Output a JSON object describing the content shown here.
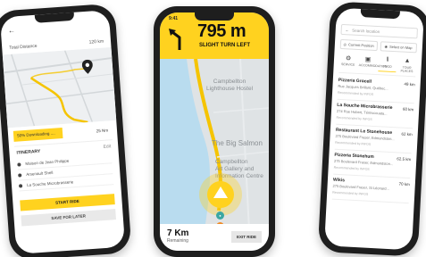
{
  "colors": {
    "accent": "#ffd21f",
    "route": "#f5c400",
    "water": "#b9dcef",
    "land": "#dfe3e5"
  },
  "phone1": {
    "title": "Total Distance",
    "distance": "120 km",
    "progress_text": "50%  Downloading ....",
    "progress_value": 0.5,
    "progress_right": "25 Nm",
    "itinerary": {
      "heading": "ITINERARY",
      "edit_label": "Edit",
      "items": [
        {
          "label": "Maison de Jean Philippe"
        },
        {
          "label": "Arsenault Shell"
        },
        {
          "label": "La Souche Microbrasserie"
        }
      ]
    },
    "start_button": "START RIDE",
    "save_button": "SAVE FOR LATER"
  },
  "phone2": {
    "status_time": "9:41",
    "distance": "795 m",
    "instruction": "SLIGHT TURN LEFT",
    "map_labels": {
      "lighthouse": "Campbellton\nLighthouse Hostel",
      "salmon": "The Big Salmon",
      "gallery": "Campbellton\nArt Gallery and\nInformation Centre"
    },
    "remaining_value": "7 Km",
    "remaining_label": "Remaining",
    "exit_button": "EXIT RIDE"
  },
  "phone3": {
    "search_placeholder": "Search location",
    "current_position": "Current Position",
    "select_on_map": "Select on Map",
    "categories": [
      {
        "label": "SERVICE",
        "icon": "service-icon"
      },
      {
        "label": "ACCOMMODATION",
        "icon": "bed-icon"
      },
      {
        "label": "FOOD",
        "icon": "fork-knife-icon"
      },
      {
        "label": "TOUR PLACES",
        "icon": "tour-icon"
      }
    ],
    "places": [
      {
        "name": "Pizzeria Grocell",
        "address": "Rue Jacques Brillant, Québec...",
        "rec": "Recommended by INFOS",
        "km": "49 km"
      },
      {
        "name": "La Souche Microbrasserie",
        "address": "274 Rue Hubert, Témiscouata...",
        "rec": "Recommended by INFOS",
        "km": "60 km"
      },
      {
        "name": "Restaurant Le Stonehouse",
        "address": "275 Boulevard Fraser, Edmundston...",
        "rec": "Recommended by INFOS",
        "km": "62 km"
      },
      {
        "name": "Pizzeria Stonehum",
        "address": "275 Boulevard Fraser, Edmundston...",
        "rec": "Recommended by INFOS",
        "km": "62.5 km"
      },
      {
        "name": "Wikis",
        "address": "275 Boulevard Fraser, St Léonard...",
        "rec": "Recommended by INFOS",
        "km": "70 km"
      }
    ]
  }
}
